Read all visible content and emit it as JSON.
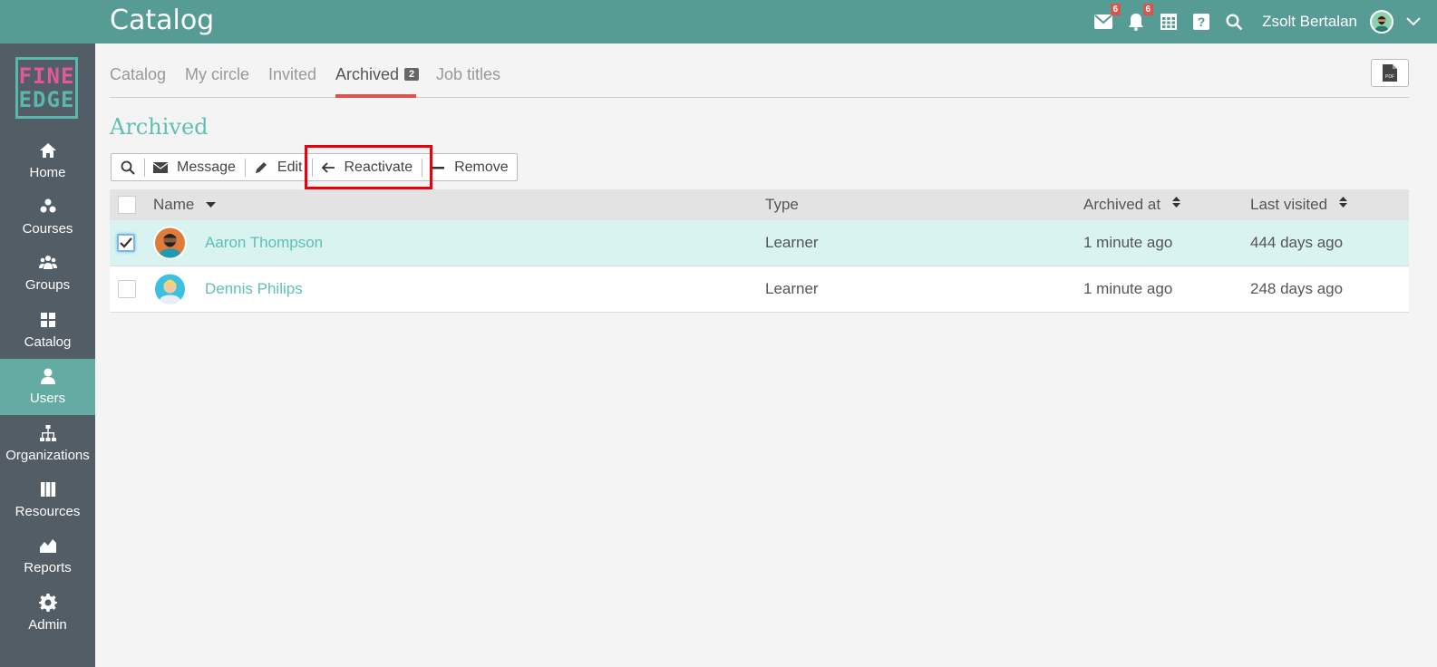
{
  "header": {
    "title": "Catalog",
    "messages_badge": "6",
    "notifications_badge": "6",
    "user_name": "Zsolt Bertalan"
  },
  "logo": {
    "line1": "FINE",
    "line2": "EDGE"
  },
  "sidebar": {
    "items": [
      {
        "label": "Home",
        "icon": "home-icon"
      },
      {
        "label": "Courses",
        "icon": "courses-icon"
      },
      {
        "label": "Groups",
        "icon": "groups-icon"
      },
      {
        "label": "Catalog",
        "icon": "catalog-icon"
      },
      {
        "label": "Users",
        "icon": "user-icon",
        "active": true
      },
      {
        "label": "Organizations",
        "icon": "organizations-icon"
      },
      {
        "label": "Resources",
        "icon": "resources-icon"
      },
      {
        "label": "Reports",
        "icon": "reports-icon"
      },
      {
        "label": "Admin",
        "icon": "gear-icon"
      }
    ]
  },
  "tabs": [
    {
      "label": "Catalog"
    },
    {
      "label": "My circle"
    },
    {
      "label": "Invited"
    },
    {
      "label": "Archived",
      "badge": "2",
      "active": true
    },
    {
      "label": "Job titles"
    }
  ],
  "pdf_button": {
    "label": "PDF"
  },
  "page": {
    "heading": "Archived"
  },
  "toolbar": {
    "message": "Message",
    "edit": "Edit",
    "reactivate": "Reactivate",
    "remove": "Remove"
  },
  "table": {
    "columns": [
      "Name",
      "Type",
      "Archived at",
      "Last visited"
    ],
    "rows": [
      {
        "name": "Aaron Thompson",
        "type": "Learner",
        "archived_at": "1 minute ago",
        "last_visited": "444 days ago",
        "selected": true
      },
      {
        "name": "Dennis Philips",
        "type": "Learner",
        "archived_at": "1 minute ago",
        "last_visited": "248 days ago",
        "selected": false
      }
    ]
  },
  "colors": {
    "topbar": "#569b94",
    "sidebar": "#535d66",
    "accent": "#5fbfb3",
    "highlight": "#e8000d",
    "badge": "#d9534f"
  }
}
